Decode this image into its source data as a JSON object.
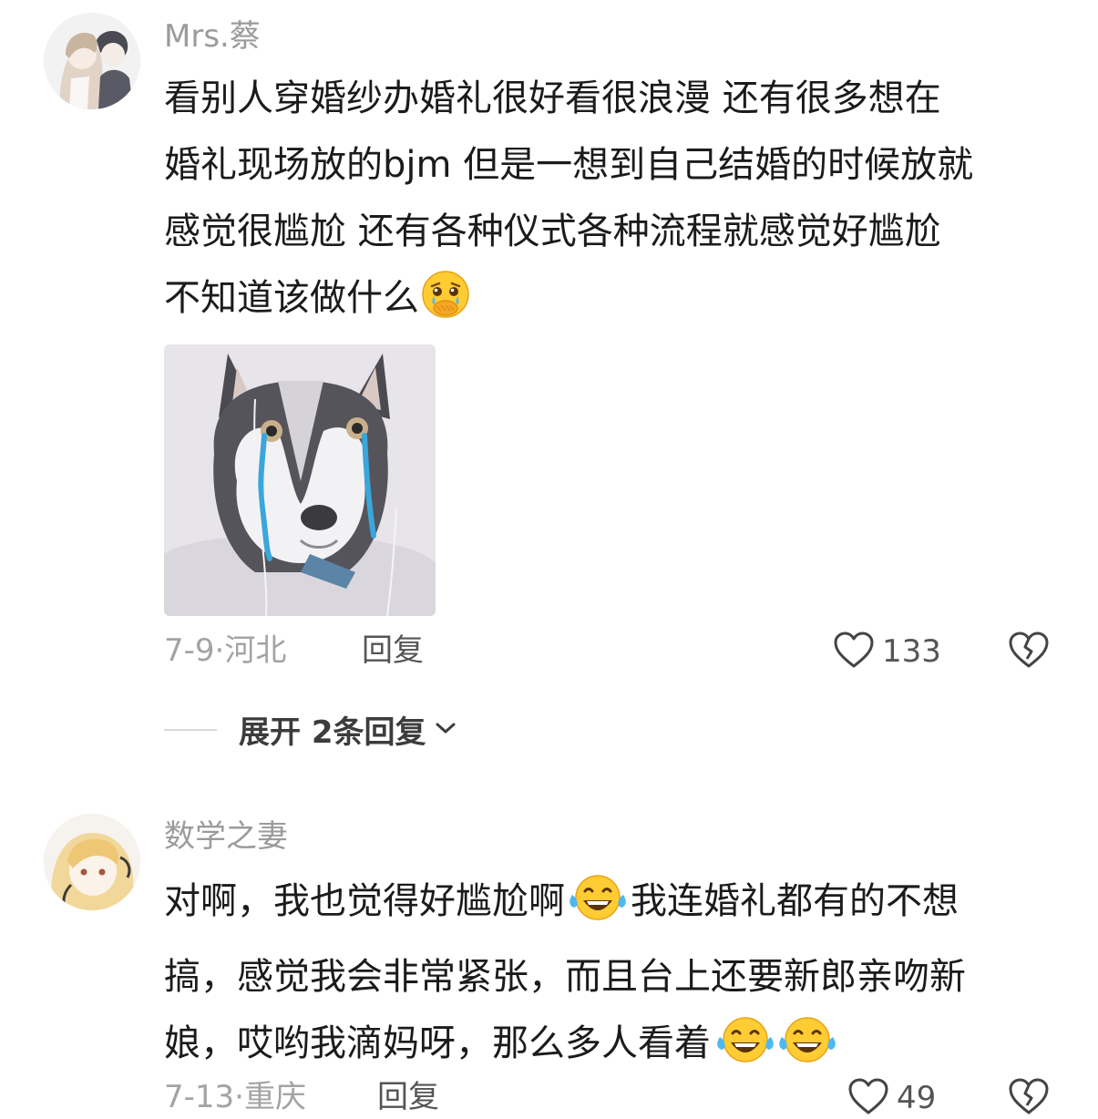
{
  "comments": [
    {
      "username": "Mrs.蔡",
      "lines": [
        "看别人穿婚纱办婚礼很好看很浪漫 还有很多想在",
        "婚礼现场放的bjm 但是一想到自己结婚的时候放就",
        "感觉很尴尬 还有各种仪式各种流程就感觉好尴尬",
        "不知道该做什么"
      ],
      "line4_emoji": "crying-face-hand-over-mouth-icon",
      "date_location": "7-9·河北",
      "reply_label": "回复",
      "likes": "133",
      "expand_label": "展开 2条回复"
    },
    {
      "username": "数学之妻",
      "lines": [
        "对啊，我也觉得好尴尬啊",
        "我连婚礼都有的不想",
        "搞，感觉我会非常紧张，而且台上还要新郎亲吻新",
        "娘，哎哟我滴妈呀，那么多人看着"
      ],
      "date_location": "7-13·重庆",
      "reply_label": "回复",
      "likes": "49"
    }
  ],
  "colors": {
    "username": "#9b9b9b",
    "text": "#1b1b1b",
    "meta": "#a3a3a3",
    "husky_tears": "#3aa6dc"
  }
}
